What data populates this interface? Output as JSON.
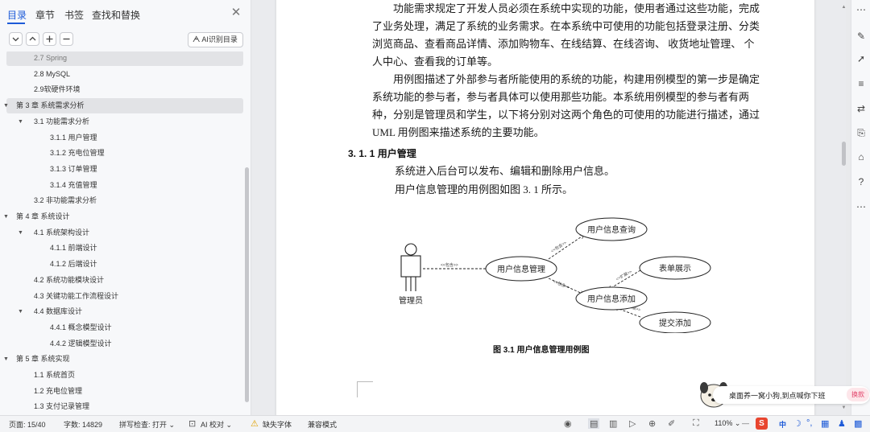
{
  "nav": {
    "tabs": [
      {
        "label": "目录"
      },
      {
        "label": "章节"
      },
      {
        "label": "书签"
      },
      {
        "label": "查找和替换"
      }
    ],
    "close_icon": "close-icon",
    "ai_toc_button": "AI识别目录",
    "toc": [
      {
        "label": "2.7  Spring",
        "level": 2,
        "selected": true,
        "partial": true
      },
      {
        "label": "2.8  MySQL",
        "level": 2
      },
      {
        "label": "2.9软硬件环境",
        "level": 2
      },
      {
        "label": "第 3 章  系统需求分析",
        "level": 1,
        "expanded": true,
        "selected": true
      },
      {
        "label": "3.1    功能需求分析",
        "level": 2,
        "expanded": true
      },
      {
        "label": "3.1.1    用户管理",
        "level": 3
      },
      {
        "label": "3.1.2    充电位管理",
        "level": 3
      },
      {
        "label": "3.1.3    订单管理",
        "level": 3
      },
      {
        "label": "3.1.4    充值管理",
        "level": 3
      },
      {
        "label": "3.2    非功能需求分析",
        "level": 2
      },
      {
        "label": "第 4 章  系统设计",
        "level": 1,
        "expanded": true
      },
      {
        "label": "4.1    系统架构设计",
        "level": 2,
        "expanded": true
      },
      {
        "label": "4.1.1    前端设计",
        "level": 3
      },
      {
        "label": "4.1.2    后端设计",
        "level": 3
      },
      {
        "label": "4.2    系统功能模块设计",
        "level": 2
      },
      {
        "label": "4.3    关键功能工作流程设计",
        "level": 2
      },
      {
        "label": "4.4    数据库设计",
        "level": 2,
        "expanded": true
      },
      {
        "label": "4.4.1    概念模型设计",
        "level": 3
      },
      {
        "label": "4.4.2    逻辑模型设计",
        "level": 3
      },
      {
        "label": "第 5 章  系统实现",
        "level": 1,
        "expanded": true
      },
      {
        "label": "1.1  系统首页",
        "level": 2
      },
      {
        "label": "1.2  充电位管理",
        "level": 2
      },
      {
        "label": "1.3  支付记录管理",
        "level": 2
      }
    ]
  },
  "doc": {
    "para1_lines": [
      "功能需求规定了开发人员必须在系统中实现的功能，使用者通过这些功能，完成",
      "了业务处理，满足了系统的业务需求。在本系统中可使用的功能包括登录注册、分类",
      "浏览商品、查看商品详情、添加购物车、在线结算、在线咨询、 收货地址管理、 个",
      "人中心、查看我的订单等。"
    ],
    "para2_lines": [
      "用例图描述了外部参与者所能使用的系统的功能，构建用例模型的第一步是确定",
      "系统功能的参与者，参与者具体可以使用那些功能。本系统用例模型的参与者有两",
      "种，分别是管理员和学生，以下将分别对这两个角色的可使用的功能进行描述，通过",
      "UML 用例图来描述系统的主要功能。"
    ],
    "section_heading": "3. 1. 1    用户管理",
    "para3": "系统进入后台可以发布、编辑和删除用户信息。",
    "para4": "用户信息管理的用例图如图 3. 1 所示。",
    "diagram": {
      "actor": "管理员",
      "usecases": {
        "main": "用户信息管理",
        "query": "用户信息查询",
        "add": "用户信息添加",
        "show": "表单展示",
        "submit": "提交添加"
      },
      "edge_labels": {
        "actor_main": "<<包含>>",
        "main_query": "<<包含>>",
        "main_add": "<<包含>>",
        "add_show": "<<扩展>>",
        "add_submit": "<<扩展>>"
      }
    },
    "figure_caption": "图 3.1  用户信息管理用例图"
  },
  "notification": {
    "text": "桌面养一窝小狗,到点喊你下班",
    "button": "换款"
  },
  "status": {
    "page": "页面: 15/40",
    "words": "字数: 14829",
    "spell": "拼写检查: 打开",
    "ai_check": "AI 校对",
    "missing_font": "缺失字体",
    "compat": "兼容模式",
    "zoom": "110%"
  },
  "colors": {
    "accent": "#1e5bd8",
    "tray_brand": "#e8452f"
  }
}
